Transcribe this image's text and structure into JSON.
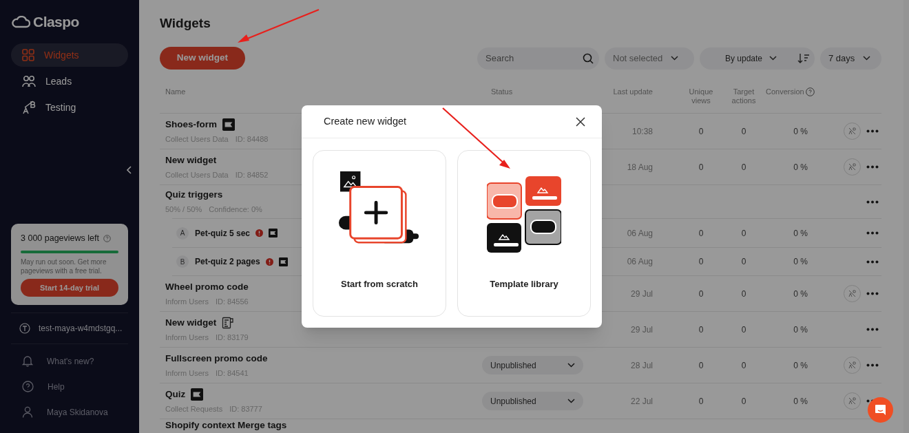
{
  "sidebar": {
    "logo": "Claspo",
    "nav": [
      {
        "label": "Widgets",
        "selected": true
      },
      {
        "label": "Leads",
        "selected": false
      },
      {
        "label": "Testing",
        "selected": false
      }
    ],
    "usage_card": {
      "title": "3 000 pageviews left",
      "level": 1,
      "message": "May run out soon. Get more pageviews with a free trial.",
      "button": "Start 14-day trial"
    },
    "workspace": "test-maya-w4mdstgq...",
    "footer": [
      {
        "label": "What's new?"
      },
      {
        "label": "Help"
      },
      {
        "label": "Maya Skidanova"
      }
    ]
  },
  "header": {
    "title": "Widgets",
    "new_button": "New widget",
    "search": {
      "placeholder": "Search"
    },
    "filter": "Not selected",
    "sort": "By update",
    "period": "7 days"
  },
  "table": {
    "columns": [
      "Name",
      "Status",
      "Last update",
      "Unique views",
      "Target actions",
      "Conversion"
    ],
    "rows": [
      {
        "kind": "flag-badge",
        "name": "Shoes-form",
        "type": "Collect Users Data",
        "id": "ID: 84488",
        "last_update": "10:38",
        "unique_views": "0",
        "target_actions": "0",
        "conversion": "0 %",
        "ab_button": true
      },
      {
        "kind": "plain",
        "name": "New widget",
        "type": "Collect Users Data",
        "id": "ID: 84852",
        "last_update": "18 Aug",
        "unique_views": "0",
        "target_actions": "0",
        "conversion": "0 %",
        "ab_button": true
      },
      {
        "kind": "group",
        "name": "Quiz triggers",
        "type": "50% / 50%",
        "id": "Confidence: 0%",
        "children": [
          {
            "kind": "flag-badge",
            "variant": "A",
            "name": "Pet-quiz 5 sec",
            "warning": true,
            "last_update": "06 Aug",
            "unique_views": "0",
            "target_actions": "0",
            "conversion": "0 %",
            "ab_button": false
          },
          {
            "kind": "flag-badge",
            "variant": "B",
            "name": "Pet-quiz 2 pages",
            "warning": true,
            "last_update": "06 Aug",
            "unique_views": "0",
            "target_actions": "0",
            "conversion": "0 %",
            "ab_button": false
          }
        ]
      },
      {
        "kind": "plain",
        "name": "Wheel promo code",
        "type": "Inform Users",
        "id": "ID: 84556",
        "last_update": "29 Jul",
        "unique_views": "0",
        "target_actions": "0",
        "conversion": "0 %",
        "ab_button": true
      },
      {
        "kind": "form-badge",
        "name": "New widget",
        "type": "Inform Users",
        "id": "ID: 83179",
        "last_update": "29 Jul",
        "unique_views": "0",
        "target_actions": "0",
        "conversion": "0 %",
        "ab_button": false
      },
      {
        "kind": "plain",
        "name": "Fullscreen promo code",
        "type": "Inform Users",
        "id": "ID: 84541",
        "status": "Unpublished",
        "last_update": "28 Jul",
        "unique_views": "0",
        "target_actions": "0",
        "conversion": "0 %",
        "ab_button": true
      },
      {
        "kind": "flag-badge",
        "name": "Quiz",
        "type": "Collect Requests",
        "id": "ID: 83777",
        "status": "Unpublished",
        "last_update": "22 Jul",
        "unique_views": "0",
        "target_actions": "0",
        "conversion": "0 %",
        "ab_button": true
      },
      {
        "kind": "plain",
        "name": "Shopify context Merge tags"
      }
    ]
  },
  "modal": {
    "title": "Create new widget",
    "options": [
      {
        "kind": "scratch",
        "label": "Start from scratch"
      },
      {
        "kind": "template",
        "label": "Template library"
      }
    ]
  }
}
